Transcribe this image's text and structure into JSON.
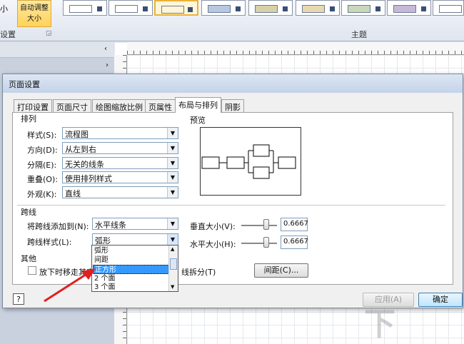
{
  "ribbon": {
    "size_label_fragment": "小",
    "autosize_label": "自动调整\n大小",
    "group_left": "设置",
    "group_main": "主题"
  },
  "dialog": {
    "title": "页面设置",
    "tabs": [
      {
        "label": "打印设置",
        "active": false
      },
      {
        "label": "页面尺寸",
        "active": false
      },
      {
        "label": "绘图缩放比例",
        "active": false
      },
      {
        "label": "页属性",
        "active": false
      },
      {
        "label": "布局与排列",
        "active": true
      },
      {
        "label": "阴影",
        "active": false
      }
    ],
    "layout": {
      "section": "排列",
      "style_label": "样式(S):",
      "style_value": "流程图",
      "direction_label": "方向(D):",
      "direction_value": "从左到右",
      "separation_label": "分隔(E):",
      "separation_value": "无关的线条",
      "overlap_label": "重叠(O):",
      "overlap_value": "使用排列样式",
      "appearance_label": "外观(K):",
      "appearance_value": "直线"
    },
    "preview": {
      "label": "预览"
    },
    "jumps": {
      "section": "跨线",
      "add_label": "将跨线添加到(N):",
      "add_value": "水平线条",
      "style_label": "跨线样式(L):",
      "style_value": "弧形",
      "vsize_label": "垂直大小(V):",
      "vsize_value": "0.6667",
      "vsize_level": 0.7,
      "hsize_label": "水平大小(H):",
      "hsize_value": "0.6667",
      "hsize_level": 0.7,
      "options": [
        "弧形",
        "间距",
        "正方形",
        "2 个面",
        "3 个面"
      ],
      "selected_index": 2
    },
    "other": {
      "section": "其他",
      "move_checkbox_label": "放下时移走其它",
      "split_label": "线拆分(T)",
      "spacing_button": "间距(C)...",
      "move_checked": false
    },
    "footer": {
      "help_icon": "?",
      "apply": "应用(A)",
      "ok": "确定"
    }
  }
}
